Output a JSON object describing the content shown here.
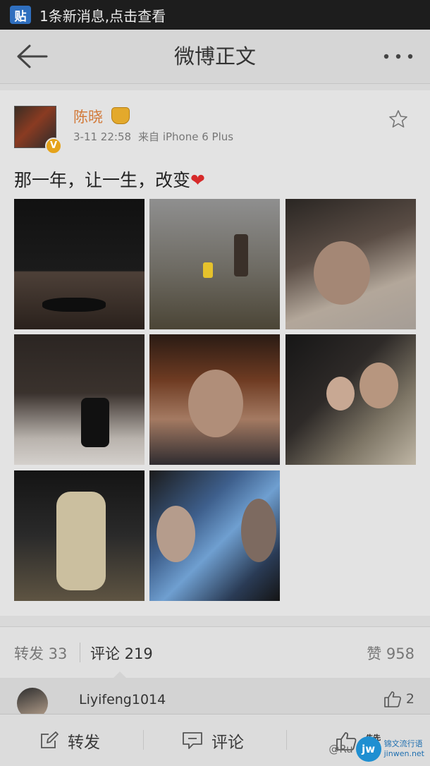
{
  "notification": {
    "badge": "贴",
    "text": "1条新消息,点击查看"
  },
  "header": {
    "title": "微博正文"
  },
  "post": {
    "author": "陈晓",
    "time": "3-11 22:58",
    "source": "来自 iPhone 6 Plus",
    "text": "那一年，让一生，改变",
    "heart": "❤"
  },
  "counts": {
    "repost": "转发 33",
    "comment": "评论 219",
    "like": "赞 958"
  },
  "comment_preview": {
    "name": "Liyifeng1014",
    "likes": "2"
  },
  "actions": {
    "repost": "转发",
    "comment": "评论",
    "like": "赞"
  },
  "watermark": {
    "handle": "@Ru",
    "logo": "jw",
    "line1": "锦文流行语",
    "line2": "jinwen.net"
  },
  "colors": {
    "accent": "#d27a3a",
    "heart": "#d62a2a",
    "badge": "#2f6fbf"
  }
}
